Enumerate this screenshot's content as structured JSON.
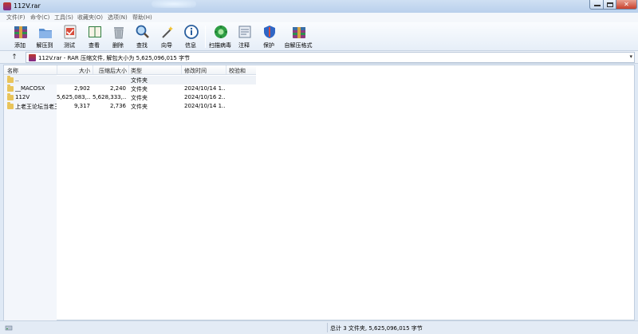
{
  "window": {
    "title": "112V.rar"
  },
  "menu": [
    "文件(F)",
    "命令(C)",
    "工具(S)",
    "收藏夹(O)",
    "选项(N)",
    "帮助(H)"
  ],
  "toolbar": {
    "buttons": [
      {
        "label": "添加",
        "icon": "add-archive-icon"
      },
      {
        "label": "解压到",
        "icon": "extract-to-icon"
      },
      {
        "label": "测试",
        "icon": "test-icon"
      },
      {
        "label": "查看",
        "icon": "view-book-icon"
      },
      {
        "label": "删除",
        "icon": "trash-icon"
      },
      {
        "label": "查找",
        "icon": "magnifier-icon"
      },
      {
        "label": "向导",
        "icon": "wizard-wand-icon"
      },
      {
        "label": "信息",
        "icon": "info-icon"
      },
      {
        "label": "扫描病毒",
        "icon": "virus-scan-icon"
      },
      {
        "label": "注释",
        "icon": "comment-icon"
      },
      {
        "label": "保护",
        "icon": "shield-icon"
      },
      {
        "label": "自解压格式",
        "icon": "sfx-archive-icon"
      }
    ]
  },
  "address": {
    "text": "112V.rar - RAR 压缩文件, 解包大小为 5,625,096,015 字节"
  },
  "columns": [
    "名称",
    "大小",
    "压缩后大小",
    "类型",
    "修改时间",
    "校验和"
  ],
  "rows": [
    {
      "name": "..",
      "size": "",
      "packed": "",
      "type": "文件夹",
      "modified": "",
      "crc": ""
    },
    {
      "name": "__MACOSX",
      "size": "2,902",
      "packed": "2,240",
      "type": "文件夹",
      "modified": "2024/10/14 1...",
      "crc": ""
    },
    {
      "name": "112V",
      "size": "5,625,083,...",
      "packed": "5,628,333,...",
      "type": "文件夹",
      "modified": "2024/10/16 2...",
      "crc": ""
    },
    {
      "name": "上老王论坛当老王",
      "size": "9,317",
      "packed": "2,736",
      "type": "文件夹",
      "modified": "2024/10/14 1...",
      "crc": ""
    }
  ],
  "status": {
    "text": "总计 3 文件夹, 5,625,096,015 字节"
  },
  "colors": {
    "accent": "#3a6ea5",
    "folder": "#e9c45a",
    "close": "#c8412c"
  }
}
